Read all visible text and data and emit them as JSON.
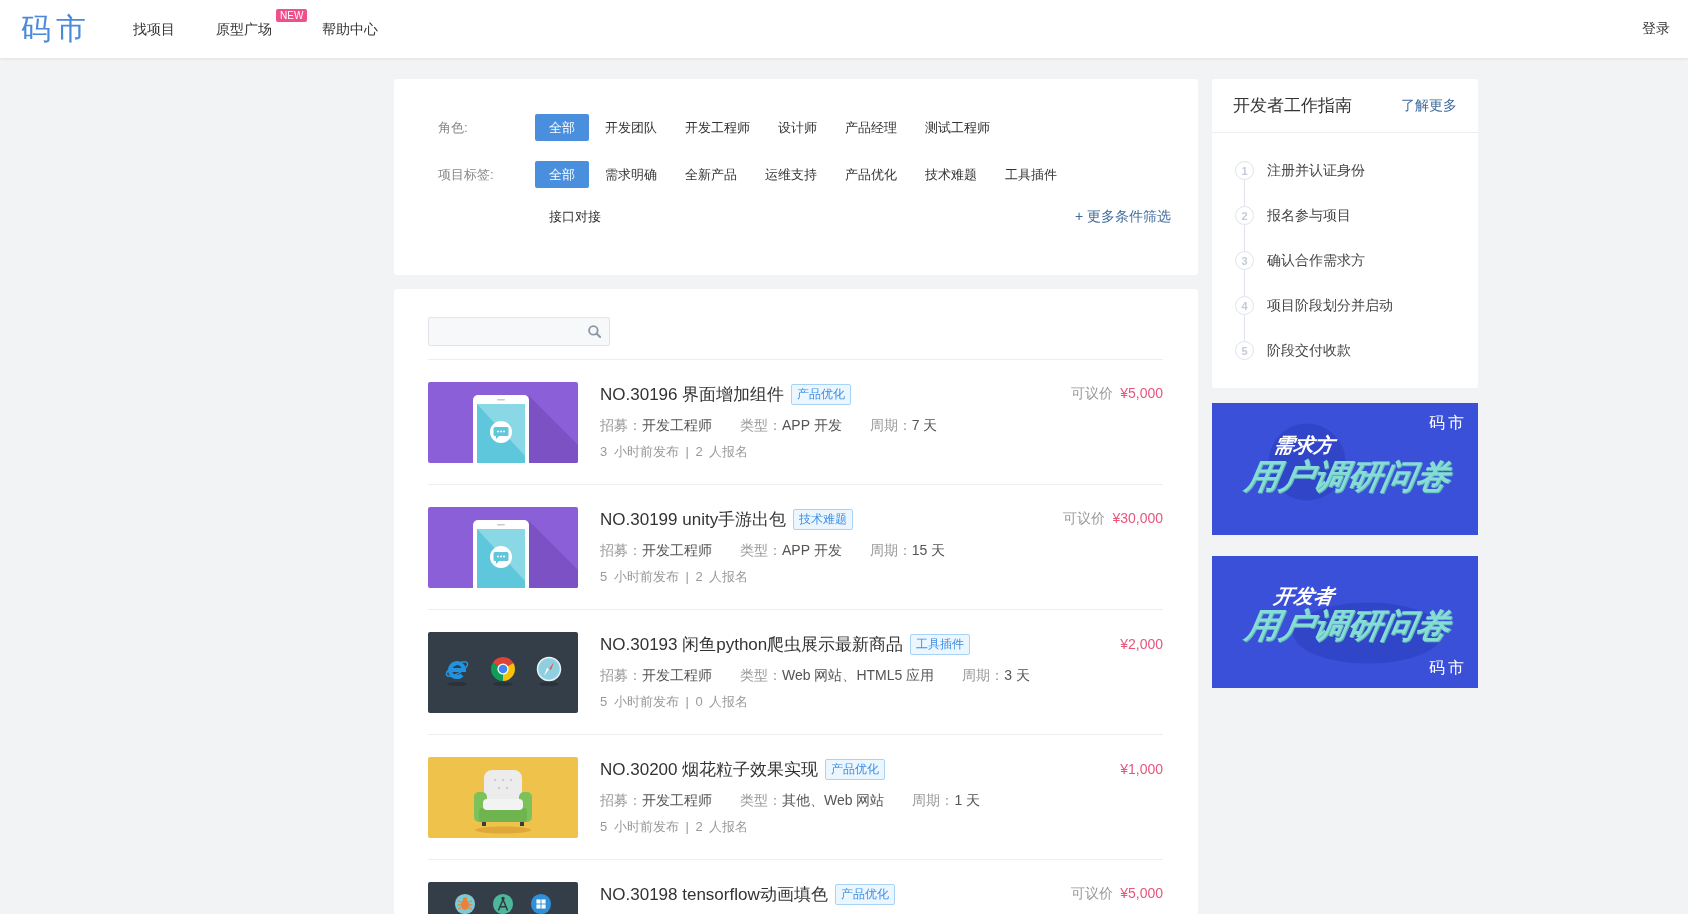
{
  "header": {
    "logo": "码市",
    "nav": [
      {
        "label": "找项目"
      },
      {
        "label": "原型广场",
        "badge": "NEW"
      },
      {
        "label": "帮助中心"
      }
    ],
    "login": "登录"
  },
  "filters": {
    "rows": [
      {
        "label": "角色:",
        "options": [
          {
            "label": "全部",
            "selected": true
          },
          {
            "label": "开发团队",
            "selected": false
          },
          {
            "label": "开发工程师",
            "selected": false
          },
          {
            "label": "设计师",
            "selected": false
          },
          {
            "label": "产品经理",
            "selected": false
          },
          {
            "label": "测试工程师",
            "selected": false
          }
        ]
      },
      {
        "label": "项目标签:",
        "options": [
          {
            "label": "全部",
            "selected": true
          },
          {
            "label": "需求明确",
            "selected": false
          },
          {
            "label": "全新产品",
            "selected": false
          },
          {
            "label": "运维支持",
            "selected": false
          },
          {
            "label": "产品优化",
            "selected": false
          },
          {
            "label": "技术难题",
            "selected": false
          },
          {
            "label": "工具插件",
            "selected": false
          },
          {
            "label": "接口对接",
            "selected": false
          }
        ]
      }
    ],
    "more": "+ 更多条件筛选"
  },
  "projects": [
    {
      "kind": "phone",
      "title": "NO.30196 界面增加组件",
      "tag": "产品优化",
      "price_note": "可议价",
      "price": "¥5,000",
      "meta": [
        {
          "label": "招募：",
          "value": "开发工程师"
        },
        {
          "label": "类型：",
          "value": "APP 开发"
        },
        {
          "label": "周期：",
          "value": "7 天"
        }
      ],
      "stats": "3 小时前发布 | 2 人报名"
    },
    {
      "kind": "phone",
      "title": "NO.30199 unity手游出包",
      "tag": "技术难题",
      "price_note": "可议价",
      "price": "¥30,000",
      "meta": [
        {
          "label": "招募：",
          "value": "开发工程师"
        },
        {
          "label": "类型：",
          "value": "APP 开发"
        },
        {
          "label": "周期：",
          "value": "15 天"
        }
      ],
      "stats": "5 小时前发布 | 2 人报名"
    },
    {
      "kind": "browsers",
      "title": "NO.30193 闲鱼python爬虫展示最新商品",
      "tag": "工具插件",
      "price": "¥2,000",
      "meta": [
        {
          "label": "招募：",
          "value": "开发工程师"
        },
        {
          "label": "类型：",
          "value": "Web 网站、HTML5 应用"
        },
        {
          "label": "周期：",
          "value": "3 天"
        }
      ],
      "stats": "5 小时前发布 | 0 人报名"
    },
    {
      "kind": "armchair",
      "title": "NO.30200 烟花粒子效果实现",
      "tag": "产品优化",
      "price": "¥1,000",
      "meta": [
        {
          "label": "招募：",
          "value": "开发工程师"
        },
        {
          "label": "类型：",
          "value": "其他、Web 网站"
        },
        {
          "label": "周期：",
          "value": "1 天"
        }
      ],
      "stats": "5 小时前发布 | 2 人报名"
    },
    {
      "kind": "tools",
      "title": "NO.30198 tensorflow动画填色",
      "tag": "产品优化",
      "price_note": "可议价",
      "price": "¥5,000"
    }
  ],
  "guide": {
    "title": "开发者工作指南",
    "more": "了解更多",
    "steps": [
      {
        "number": "1",
        "label": "注册并认证身份"
      },
      {
        "number": "2",
        "label": "报名参与项目"
      },
      {
        "number": "3",
        "label": "确认合作需求方"
      },
      {
        "number": "4",
        "label": "项目阶段划分并启动"
      },
      {
        "number": "5",
        "label": "阶段交付收款"
      }
    ]
  },
  "banners": [
    {
      "kind": "top",
      "tag": "需求方",
      "title": "用户调研问卷",
      "brand": "码市"
    },
    {
      "kind": "bottom",
      "tag": "开发者",
      "title": "用户调研问卷",
      "brand": "码市"
    }
  ]
}
